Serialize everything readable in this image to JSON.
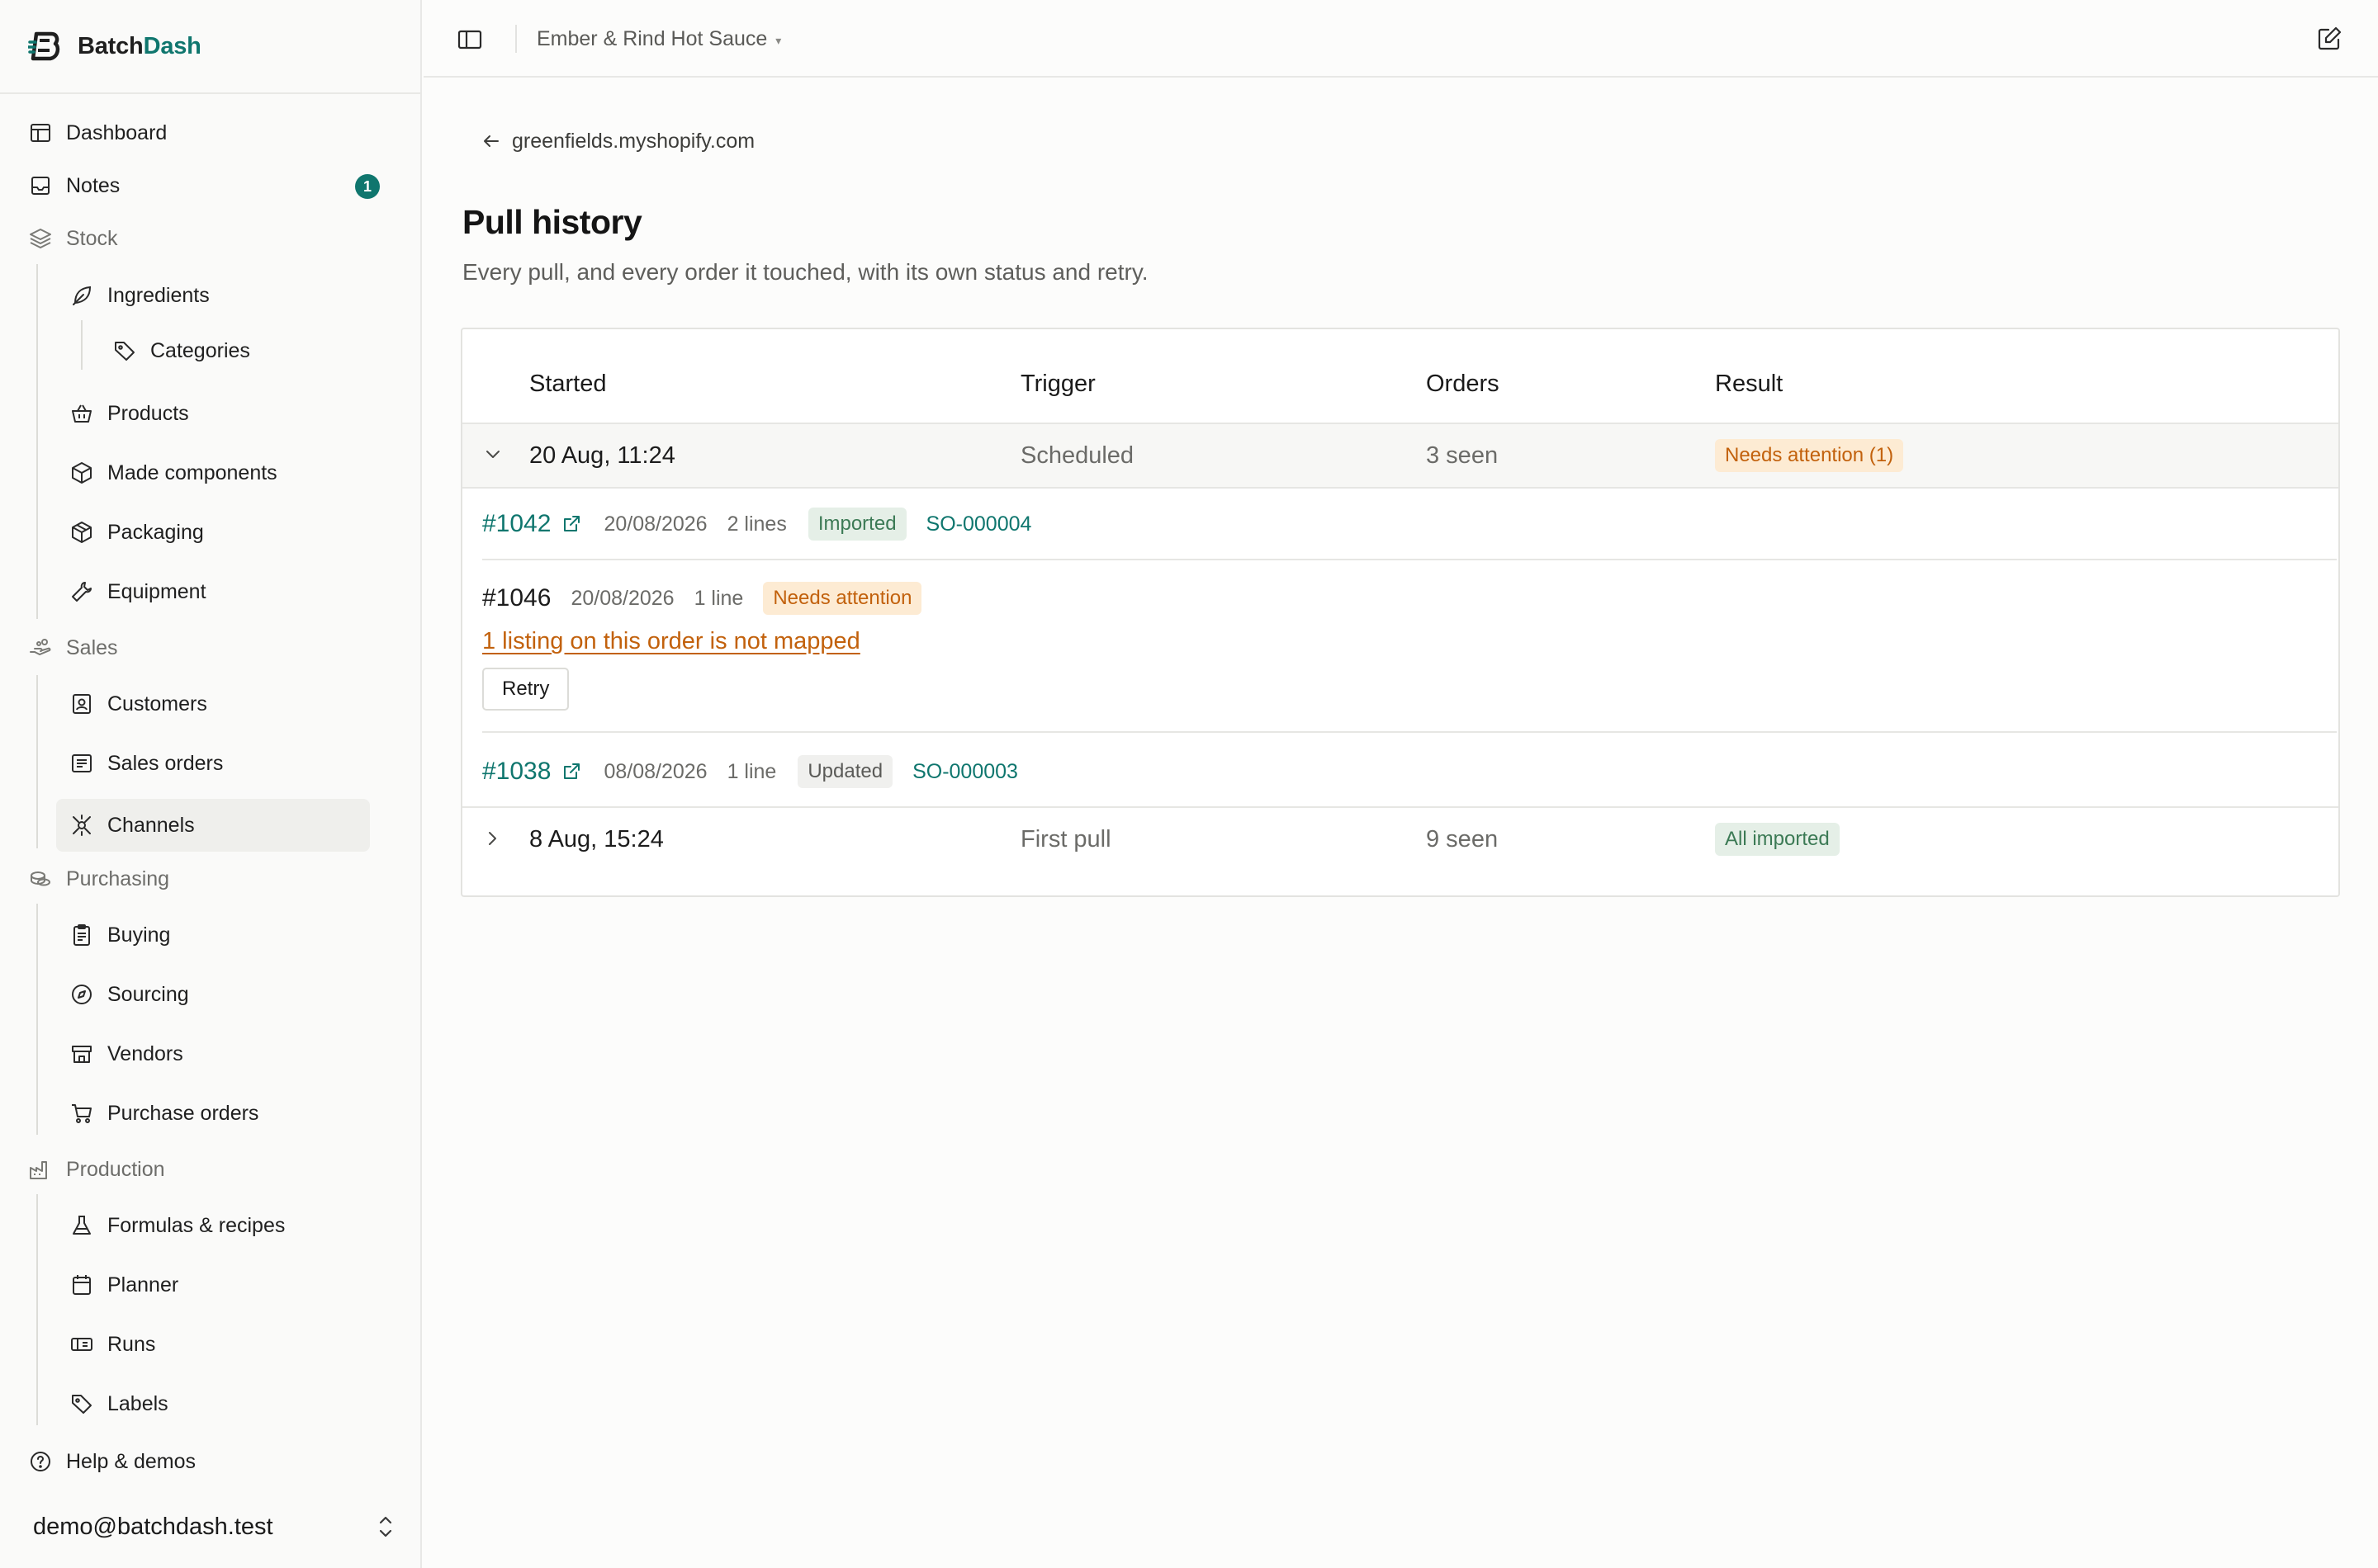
{
  "brand": {
    "name_part1": "Batch",
    "name_part2": "Dash",
    "accent_color": "#0f766e"
  },
  "sidebar": {
    "dashboard": {
      "label": "Dashboard",
      "icon": "dashboard-icon"
    },
    "notes": {
      "label": "Notes",
      "badge": "1",
      "icon": "inbox-icon"
    },
    "stock": {
      "label": "Stock",
      "icon": "layers-icon"
    },
    "ingredients": {
      "label": "Ingredients",
      "icon": "leaf-icon"
    },
    "categories": {
      "label": "Categories",
      "icon": "tag-icon"
    },
    "products": {
      "label": "Products",
      "icon": "basket-icon"
    },
    "made_components": {
      "label": "Made components",
      "icon": "box-icon"
    },
    "packaging": {
      "label": "Packaging",
      "icon": "package-icon"
    },
    "equipment": {
      "label": "Equipment",
      "icon": "wrench-icon"
    },
    "sales": {
      "label": "Sales",
      "icon": "hand-coins-icon"
    },
    "customers": {
      "label": "Customers",
      "icon": "contact-icon"
    },
    "sales_orders": {
      "label": "Sales orders",
      "icon": "receipt-icon"
    },
    "channels": {
      "label": "Channels",
      "icon": "network-icon",
      "active": true
    },
    "purchasing": {
      "label": "Purchasing",
      "icon": "coins-icon"
    },
    "buying": {
      "label": "Buying",
      "icon": "clipboard-icon"
    },
    "sourcing": {
      "label": "Sourcing",
      "icon": "compass-icon"
    },
    "vendors": {
      "label": "Vendors",
      "icon": "store-icon"
    },
    "purchase_orders": {
      "label": "Purchase orders",
      "icon": "cart-icon"
    },
    "production": {
      "label": "Production",
      "icon": "factory-icon"
    },
    "formulas": {
      "label": "Formulas & recipes",
      "icon": "flask-icon"
    },
    "planner": {
      "label": "Planner",
      "icon": "calendar-icon"
    },
    "runs": {
      "label": "Runs",
      "icon": "ticket-icon"
    },
    "labels": {
      "label": "Labels",
      "icon": "tag-icon"
    },
    "help": {
      "label": "Help & demos",
      "icon": "help-circle-icon"
    },
    "user_email": "demo@batchdash.test"
  },
  "topbar": {
    "workspace": "Ember & Rind Hot Sauce",
    "caret": "▾"
  },
  "main": {
    "back_link": "greenfields.myshopify.com",
    "title": "Pull history",
    "subtitle": "Every pull, and every order it touched, with its own status and retry."
  },
  "table": {
    "columns": {
      "started": "Started",
      "trigger": "Trigger",
      "orders": "Orders",
      "result": "Result"
    },
    "runs": [
      {
        "started": "20 Aug, 11:24",
        "trigger": "Scheduled",
        "orders": "3 seen",
        "result": "Needs attention (1)",
        "expanded": true,
        "order_rows": [
          {
            "number": "#1042",
            "date": "20/08/2026",
            "lines": "2 lines",
            "status": "Imported",
            "sales_order": "SO-000004"
          },
          {
            "number": "#1046",
            "date": "20/08/2026",
            "lines": "1 line",
            "status": "Needs attention",
            "issue": "1 listing on this order is not mapped",
            "retry": "Retry"
          },
          {
            "number": "#1038",
            "date": "08/08/2026",
            "lines": "1 line",
            "status": "Updated",
            "sales_order": "SO-000003"
          }
        ]
      },
      {
        "started": "8 Aug, 15:24",
        "trigger": "First pull",
        "orders": "9 seen",
        "result": "All imported",
        "expanded": false
      }
    ]
  },
  "colors": {
    "warning": "#c2610c",
    "success": "#3c7a55",
    "link": "#0f766e"
  }
}
